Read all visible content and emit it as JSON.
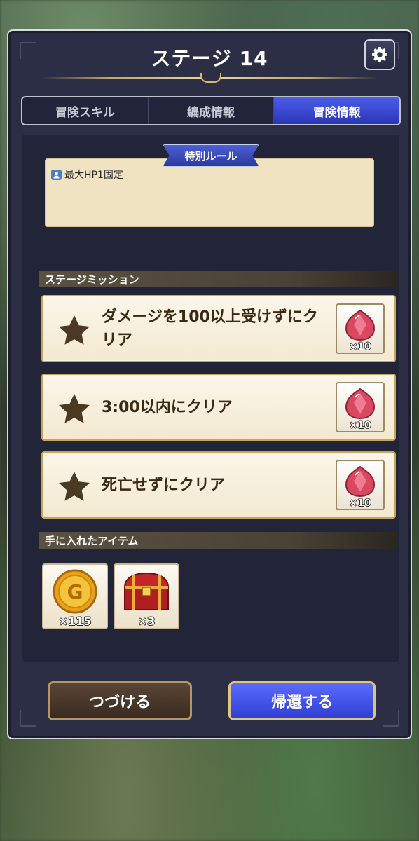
{
  "dialog": {
    "title": "ステージ 14",
    "tabs": [
      {
        "label": "冒険スキル",
        "active": false
      },
      {
        "label": "編成情報",
        "active": false
      },
      {
        "label": "冒険情報",
        "active": true
      }
    ]
  },
  "special_rule": {
    "header": "特別ルール",
    "text": "最大HP1固定"
  },
  "missions": {
    "header": "ステージミッション",
    "items": [
      {
        "text": "ダメージを100以上受けずにクリア",
        "reward_count": "×10"
      },
      {
        "text": "3:00以内にクリア",
        "reward_count": "×10"
      },
      {
        "text": "死亡せずにクリア",
        "reward_count": "×10"
      }
    ]
  },
  "items_obtained": {
    "header": "手に入れたアイテム",
    "items": [
      {
        "icon": "gold-coin-icon",
        "count": "×115"
      },
      {
        "icon": "treasure-chest-icon",
        "count": "×3"
      }
    ]
  },
  "buttons": {
    "continue": "つづける",
    "return": "帰還する"
  },
  "colors": {
    "accent_blue": "#3a4bd8",
    "gold": "#d8b86a",
    "panel": "#2b2e44",
    "card": "#f7efdc"
  }
}
